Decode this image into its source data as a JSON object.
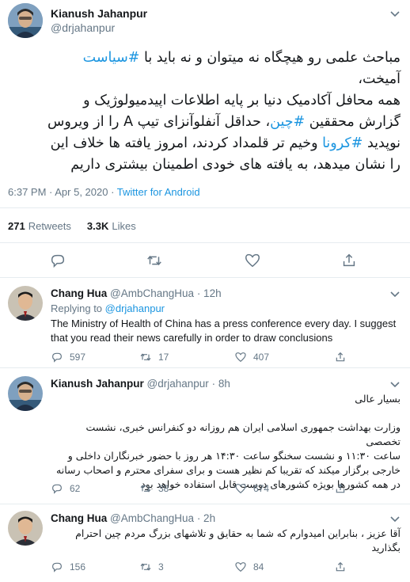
{
  "main_tweet": {
    "name": "Kianush Jahanpur",
    "handle": "@drjahanpur",
    "text_lines": [
      {
        "before": "مباحث علمی رو هیچگاه نه میتوان و نه باید با ",
        "hashtag": "#سیاست",
        "after": ""
      },
      {
        "before": "آمیخت،",
        "hashtag": "",
        "after": ""
      },
      {
        "before": "همه محافل آکادمیک دنیا بر پایه اطلاعات اپیدمیولوژیک و",
        "hashtag": "",
        "after": ""
      },
      {
        "before": "گزارش محققین ",
        "hashtag": "#چین",
        "after": "، حداقل آنفلوآنزای تیپ A را از ویروس"
      },
      {
        "before": "نوپدید ",
        "hashtag": "#کرونا",
        "after": " وخیم تر قلمداد کردند، امروز یافته ها خلاف این"
      },
      {
        "before": "را نشان میدهد، به یافته های خودی اطمینان بیشتری داریم",
        "hashtag": "",
        "after": ""
      }
    ],
    "timestamp": "6:37 PM · Apr 5, 2020 · ",
    "source": "Twitter for Android",
    "retweets_count": "271",
    "retweets_label": "Retweets",
    "likes_count": "3.3K",
    "likes_label": "Likes"
  },
  "replies": [
    {
      "name": "Chang Hua",
      "handle": "@AmbChangHua",
      "time": "· 12h",
      "replying_prefix": "Replying to ",
      "replying_to": "@drjahanpur",
      "text_lines": [
        "The Ministry of Health of China has a press conference every day. I suggest",
        "that you read their news carefully in order to draw conclusions"
      ],
      "reply_count": "597",
      "retweet_count": "17",
      "like_count": "407"
    },
    {
      "name": "Kianush Jahanpur",
      "handle": "@drjahanpur",
      "time": "· 8h",
      "text_lines": [
        "بسیار عالی",
        "",
        "وزارت بهداشت جمهوری اسلامی ایران هم روزانه دو کنفرانس خبری، نشست تخصصی",
        "ساعت ۱۱:۳۰ و نشست سخنگو ساعت ۱۴:۳۰ هر روز با حضور خبرنگاران داخلی و",
        "خارجی برگزار میکند که تقریبا کم نظیر هست و برای سفرای محترم و اصحاب رسانه",
        "در همه کشورها بویژه کشورهای دوست قابل استفاده خواهد بود"
      ],
      "reply_count": "62",
      "retweet_count": "38",
      "like_count": "674"
    },
    {
      "name": "Chang Hua",
      "handle": "@AmbChangHua",
      "time": "· 2h",
      "text_lines": [
        "آقا عزیز ، بنابراین امیدوارم که شما به حقایق و تلاشهای بزرگ مردم چین احترام",
        "بگذارید"
      ],
      "reply_count": "156",
      "retweet_count": "3",
      "like_count": "84"
    }
  ],
  "icons": {
    "reply": "reply-icon",
    "retweet": "retweet-icon",
    "like": "heart-icon",
    "share": "share-icon",
    "more": "chevron-down-icon"
  },
  "colors": {
    "link": "#1b95e0",
    "text": "#14171a",
    "secondary": "#657786",
    "divider": "#e6ecf0"
  }
}
